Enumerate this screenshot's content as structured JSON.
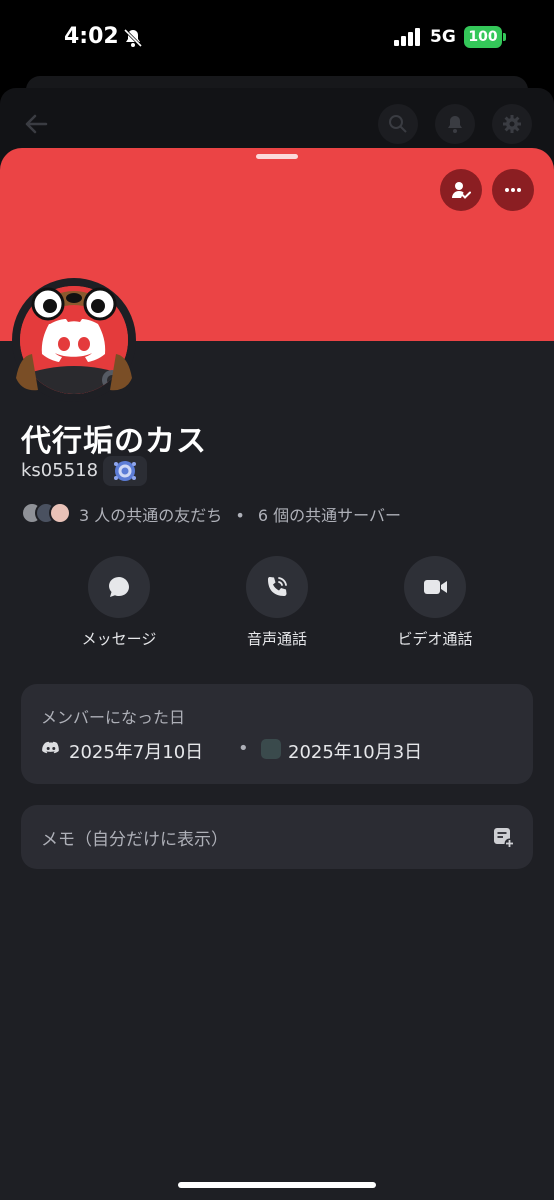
{
  "status_bar": {
    "time": "4:02",
    "network": "5G",
    "battery": "100"
  },
  "profile": {
    "display_name": "代行垢のカス",
    "username": "ks05518",
    "mutual_friends": "3 人の共通の友だち",
    "separator": "•",
    "mutual_servers": "6 個の共通サーバー"
  },
  "actions": [
    {
      "label": "メッセージ",
      "icon": "message-icon"
    },
    {
      "label": "音声通話",
      "icon": "phone-icon"
    },
    {
      "label": "ビデオ通話",
      "icon": "video-icon"
    }
  ],
  "member_since": {
    "title": "メンバーになった日",
    "discord_date": "2025年7月10日",
    "separator": "•",
    "server_date": "2025年10月3日"
  },
  "memo": {
    "placeholder": "メモ（自分だけに表示）"
  },
  "colors": {
    "banner": "#eb4445",
    "background": "#1e1f24",
    "card": "#2b2c33",
    "accent": "#5865f2"
  }
}
